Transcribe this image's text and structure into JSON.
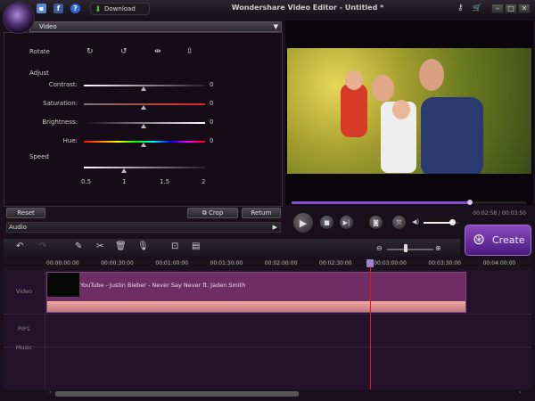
{
  "titlebar": {
    "title": "Wondershare Video Editor - Untitled *",
    "download_label": "Download",
    "minimize": "–",
    "maximize": "□",
    "close": "✕"
  },
  "editor": {
    "section": "Video",
    "rotate_label": "Rotate",
    "adjust_label": "Adjust",
    "adjustments": [
      {
        "label": "Contrast:",
        "value": "0",
        "level": 0.5
      },
      {
        "label": "Saturation:",
        "value": "0",
        "level": 0.5
      },
      {
        "label": "Brightness:",
        "value": "0",
        "level": 0.5
      },
      {
        "label": "Hue:",
        "value": "0",
        "level": 0.5
      }
    ],
    "speed_label": "Speed",
    "speed_ticks": [
      "0.5",
      "1",
      "1.5",
      "2"
    ],
    "speed_value": 1,
    "reset": "Reset",
    "crop": "Crop",
    "return": "Return",
    "audio_section": "Audio"
  },
  "player": {
    "progress": 0.76,
    "time": "00:02:58 / 00:03:50",
    "volume": 0.8
  },
  "create_label": "Create",
  "timeline": {
    "ruler": [
      "00:00:00:00",
      "00:00:30:00",
      "00:01:00:00",
      "00:01:30:00",
      "00:02:00:00",
      "00:02:30:00",
      "00:03:00:00",
      "00:03:30:00",
      "00:04:00:00"
    ],
    "tracks": [
      "Video",
      "PIP1",
      "Music"
    ],
    "clip_title": "YouTube - Justin Bieber - Never Say Never ft. Jaden Smith",
    "zoom_level": 0.4
  }
}
